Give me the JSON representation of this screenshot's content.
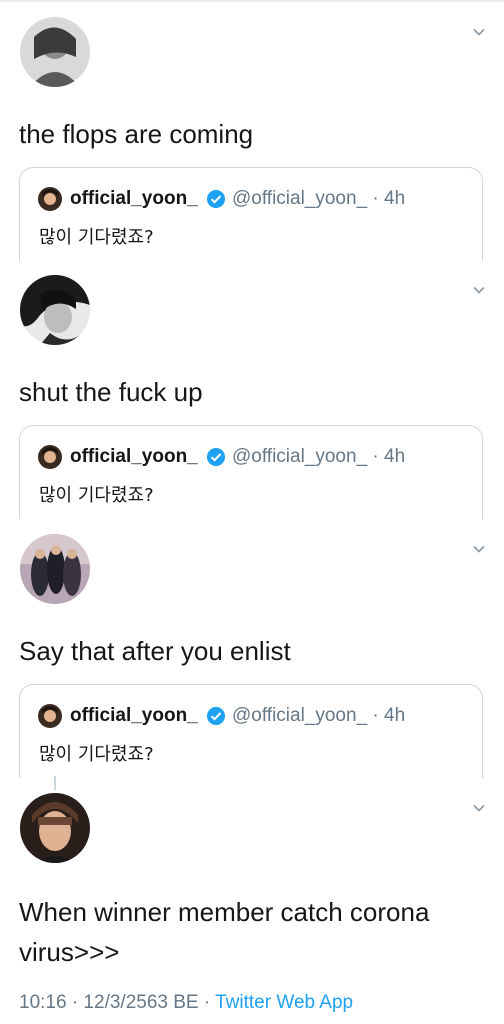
{
  "tweets": [
    {
      "text": "the flops are coming",
      "avatar_icon": "avatar-photo-gray",
      "quote": {
        "name": "official_yoon_",
        "handle": "@official_yoon_ · 4h",
        "text": "많이 기다렸죠?"
      }
    },
    {
      "text": "shut the fuck up",
      "avatar_icon": "avatar-photo-dark",
      "quote": {
        "name": "official_yoon_",
        "handle": "@official_yoon_ · 4h",
        "text": "많이 기다렸죠?"
      }
    },
    {
      "text": "Say that after you enlist",
      "avatar_icon": "avatar-photo-group",
      "quote": {
        "name": "official_yoon_",
        "handle": "@official_yoon_ · 4h",
        "text": "많이 기다렸죠?"
      }
    },
    {
      "text_line1": "When winner member catch corona",
      "text_line2": "virus>>>",
      "avatar_icon": "avatar-photo-portrait"
    }
  ],
  "meta": {
    "time_date": "10:16 · 12/3/2563 BE · ",
    "source": "Twitter Web App"
  },
  "colors": {
    "text": "#14171a",
    "secondary": "#657786",
    "link": "#1da1f2",
    "border": "#ccd6dd",
    "verified": "#1da1f2"
  }
}
